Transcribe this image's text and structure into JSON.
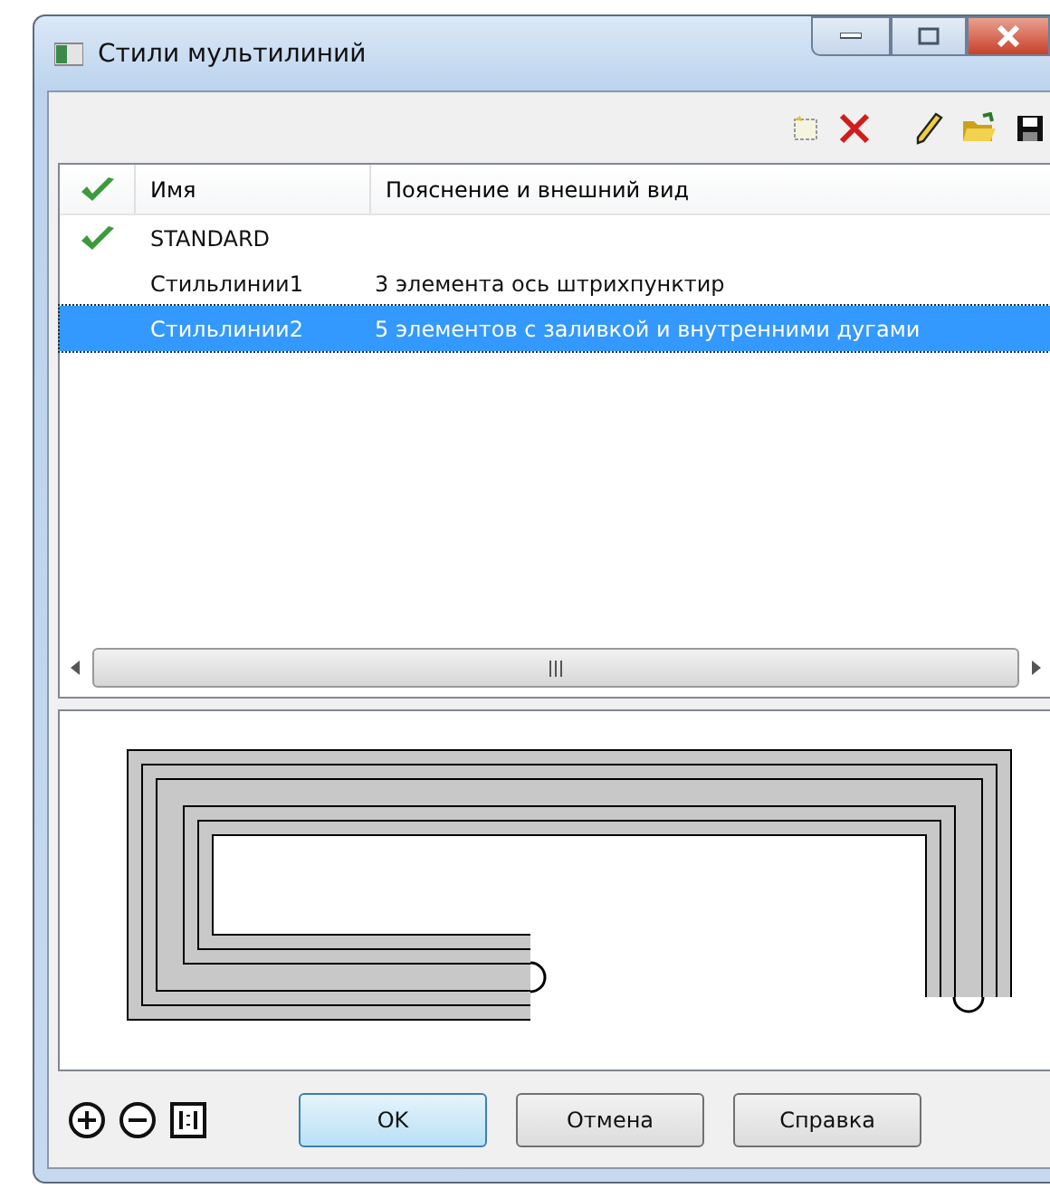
{
  "window": {
    "title": "Стили мультилиний"
  },
  "toolbar": [
    {
      "kind": "new"
    },
    {
      "kind": "delete"
    },
    {
      "kind": "edit"
    },
    {
      "kind": "open"
    },
    {
      "kind": "save"
    }
  ],
  "list": {
    "columns": [
      "Имя",
      "Пояснение и внешний вид"
    ],
    "rows": [
      {
        "name": "STANDARD",
        "current": true,
        "selected": false
      },
      {
        "name": "Стильлинии1",
        "description": "3 элемента ось штрихпунктир",
        "current": false,
        "selected": false
      },
      {
        "name": "Стильлинии2",
        "description": "5 элементов с заливкой и внутренними дугами",
        "current": false,
        "selected": true
      }
    ]
  },
  "zoom_tools": [
    {
      "kind": "zoom-in"
    },
    {
      "kind": "zoom-out"
    },
    {
      "kind": "actual-size"
    }
  ],
  "buttons": [
    {
      "label": "OK",
      "default": true
    },
    {
      "label": "Отмена",
      "default": false
    },
    {
      "label": "Справка",
      "default": false
    }
  ]
}
